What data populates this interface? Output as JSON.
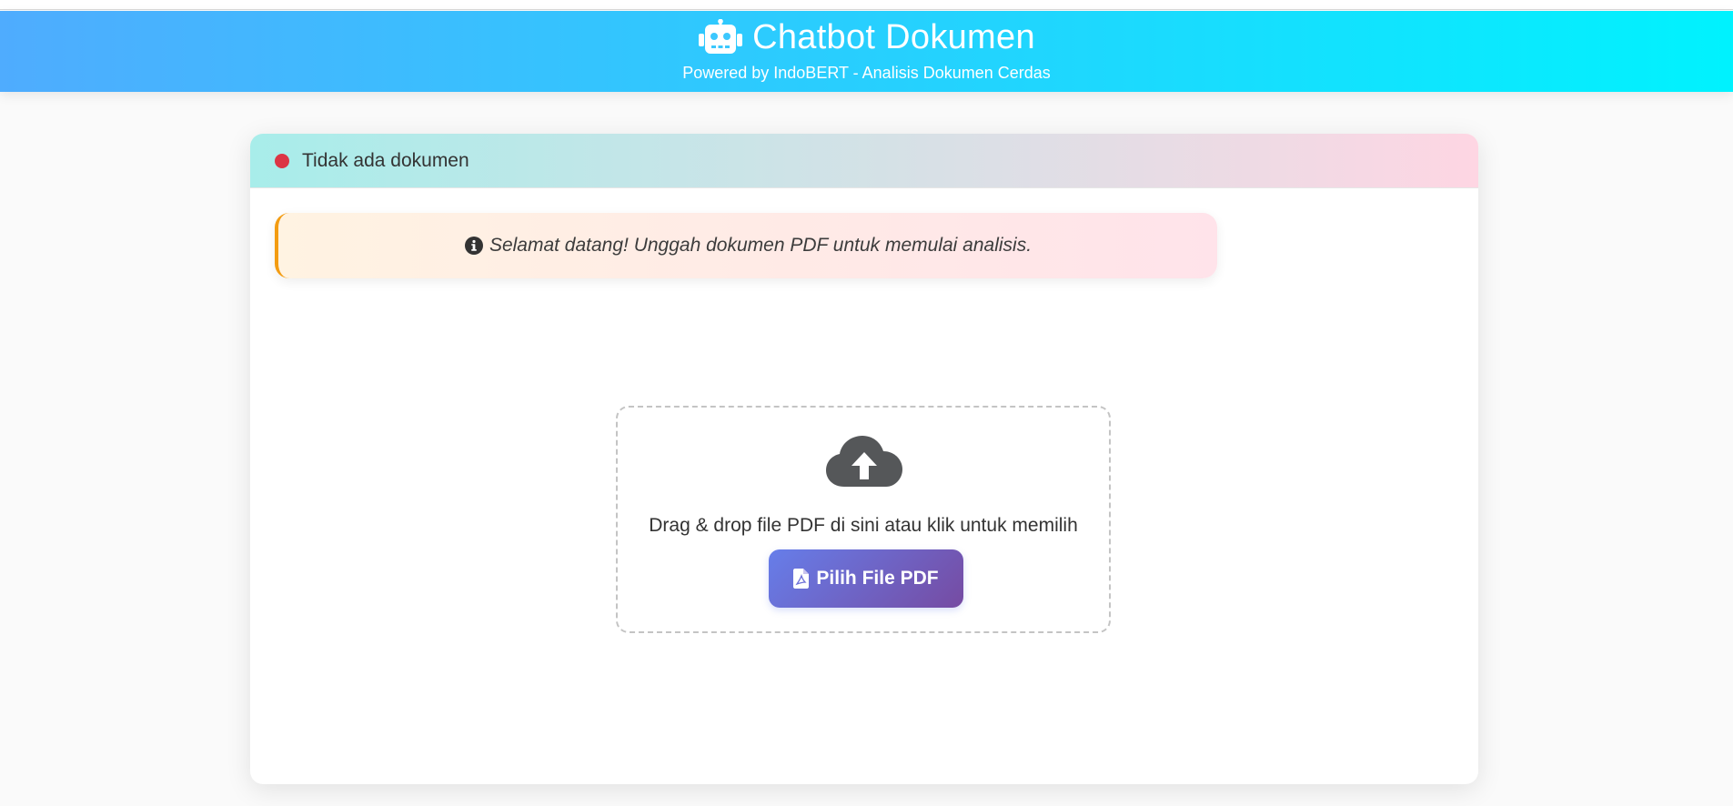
{
  "header": {
    "icon": "robot-icon",
    "title": "Chatbot Dokumen",
    "subtitle": "Powered by IndoBERT - Analisis Dokumen Cerdas"
  },
  "status": {
    "text": "Tidak ada dokumen",
    "dot_color": "#dc3545"
  },
  "welcome": {
    "icon": "info-circle-icon",
    "message": "Selamat datang! Unggah dokumen PDF untuk memulai analisis."
  },
  "upload": {
    "icon": "cloud-upload-icon",
    "instruction": "Drag & drop file PDF di sini atau klik untuk memilih",
    "button_label": "Pilih File PDF",
    "button_icon": "file-pdf-icon"
  },
  "colors": {
    "header_gradient": [
      "#4facfe",
      "#00f2fe"
    ],
    "status_gradient": [
      "#a8edea",
      "#fed6e3"
    ],
    "button_gradient": [
      "#667eea",
      "#764ba2"
    ],
    "welcome_accent": "#f39c12"
  }
}
